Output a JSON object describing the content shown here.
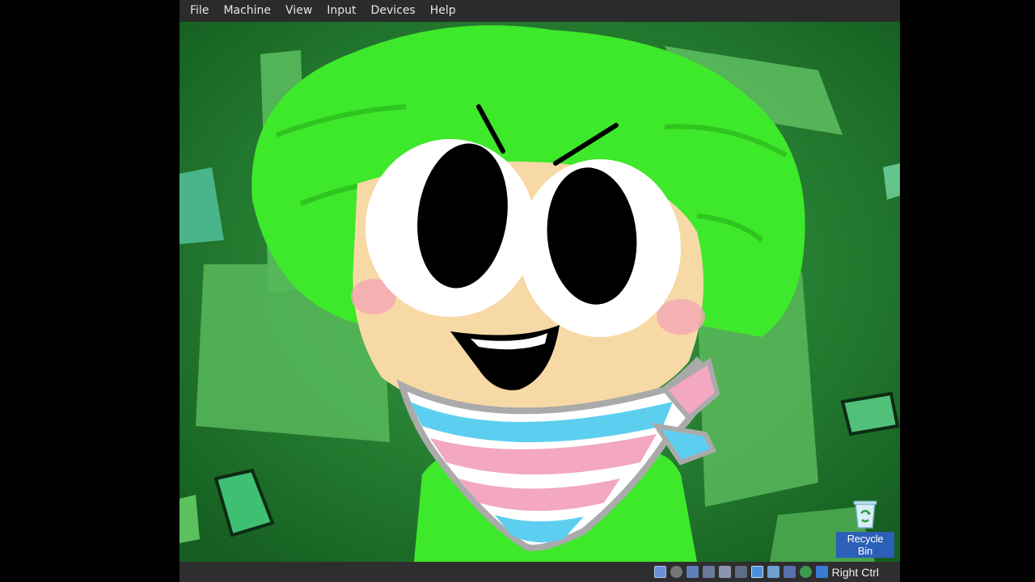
{
  "menubar": {
    "items": [
      {
        "label": "File"
      },
      {
        "label": "Machine"
      },
      {
        "label": "View"
      },
      {
        "label": "Input"
      },
      {
        "label": "Devices"
      },
      {
        "label": "Help"
      }
    ]
  },
  "desktop": {
    "recycle_bin_label": "Recycle Bin"
  },
  "statusbar": {
    "host_key_label": "Right Ctrl",
    "icons": [
      "hard-disk-icon",
      "optical-drive-icon",
      "audio-icon",
      "network-icon",
      "usb-icon",
      "shared-folders-icon",
      "display-icon",
      "video-capture-icon",
      "cpu-icon",
      "mouse-integration-icon",
      "keyboard-capture-icon"
    ]
  },
  "colors": {
    "menubar_bg": "#2b2b2b",
    "screen_bg": "#1f7a2c",
    "hair_green": "#3ee82a",
    "skin": "#f7d9a6",
    "label_bg": "#2b5fb8"
  }
}
